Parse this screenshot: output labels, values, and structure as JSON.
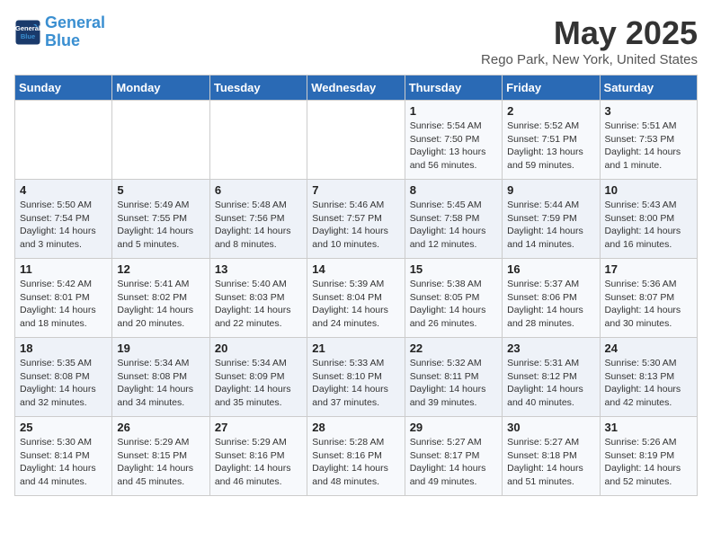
{
  "logo": {
    "line1": "General",
    "line2": "Blue"
  },
  "title": "May 2025",
  "subtitle": "Rego Park, New York, United States",
  "headers": [
    "Sunday",
    "Monday",
    "Tuesday",
    "Wednesday",
    "Thursday",
    "Friday",
    "Saturday"
  ],
  "weeks": [
    [
      {
        "num": "",
        "info": ""
      },
      {
        "num": "",
        "info": ""
      },
      {
        "num": "",
        "info": ""
      },
      {
        "num": "",
        "info": ""
      },
      {
        "num": "1",
        "info": "Sunrise: 5:54 AM\nSunset: 7:50 PM\nDaylight: 13 hours\nand 56 minutes."
      },
      {
        "num": "2",
        "info": "Sunrise: 5:52 AM\nSunset: 7:51 PM\nDaylight: 13 hours\nand 59 minutes."
      },
      {
        "num": "3",
        "info": "Sunrise: 5:51 AM\nSunset: 7:53 PM\nDaylight: 14 hours\nand 1 minute."
      }
    ],
    [
      {
        "num": "4",
        "info": "Sunrise: 5:50 AM\nSunset: 7:54 PM\nDaylight: 14 hours\nand 3 minutes."
      },
      {
        "num": "5",
        "info": "Sunrise: 5:49 AM\nSunset: 7:55 PM\nDaylight: 14 hours\nand 5 minutes."
      },
      {
        "num": "6",
        "info": "Sunrise: 5:48 AM\nSunset: 7:56 PM\nDaylight: 14 hours\nand 8 minutes."
      },
      {
        "num": "7",
        "info": "Sunrise: 5:46 AM\nSunset: 7:57 PM\nDaylight: 14 hours\nand 10 minutes."
      },
      {
        "num": "8",
        "info": "Sunrise: 5:45 AM\nSunset: 7:58 PM\nDaylight: 14 hours\nand 12 minutes."
      },
      {
        "num": "9",
        "info": "Sunrise: 5:44 AM\nSunset: 7:59 PM\nDaylight: 14 hours\nand 14 minutes."
      },
      {
        "num": "10",
        "info": "Sunrise: 5:43 AM\nSunset: 8:00 PM\nDaylight: 14 hours\nand 16 minutes."
      }
    ],
    [
      {
        "num": "11",
        "info": "Sunrise: 5:42 AM\nSunset: 8:01 PM\nDaylight: 14 hours\nand 18 minutes."
      },
      {
        "num": "12",
        "info": "Sunrise: 5:41 AM\nSunset: 8:02 PM\nDaylight: 14 hours\nand 20 minutes."
      },
      {
        "num": "13",
        "info": "Sunrise: 5:40 AM\nSunset: 8:03 PM\nDaylight: 14 hours\nand 22 minutes."
      },
      {
        "num": "14",
        "info": "Sunrise: 5:39 AM\nSunset: 8:04 PM\nDaylight: 14 hours\nand 24 minutes."
      },
      {
        "num": "15",
        "info": "Sunrise: 5:38 AM\nSunset: 8:05 PM\nDaylight: 14 hours\nand 26 minutes."
      },
      {
        "num": "16",
        "info": "Sunrise: 5:37 AM\nSunset: 8:06 PM\nDaylight: 14 hours\nand 28 minutes."
      },
      {
        "num": "17",
        "info": "Sunrise: 5:36 AM\nSunset: 8:07 PM\nDaylight: 14 hours\nand 30 minutes."
      }
    ],
    [
      {
        "num": "18",
        "info": "Sunrise: 5:35 AM\nSunset: 8:08 PM\nDaylight: 14 hours\nand 32 minutes."
      },
      {
        "num": "19",
        "info": "Sunrise: 5:34 AM\nSunset: 8:08 PM\nDaylight: 14 hours\nand 34 minutes."
      },
      {
        "num": "20",
        "info": "Sunrise: 5:34 AM\nSunset: 8:09 PM\nDaylight: 14 hours\nand 35 minutes."
      },
      {
        "num": "21",
        "info": "Sunrise: 5:33 AM\nSunset: 8:10 PM\nDaylight: 14 hours\nand 37 minutes."
      },
      {
        "num": "22",
        "info": "Sunrise: 5:32 AM\nSunset: 8:11 PM\nDaylight: 14 hours\nand 39 minutes."
      },
      {
        "num": "23",
        "info": "Sunrise: 5:31 AM\nSunset: 8:12 PM\nDaylight: 14 hours\nand 40 minutes."
      },
      {
        "num": "24",
        "info": "Sunrise: 5:30 AM\nSunset: 8:13 PM\nDaylight: 14 hours\nand 42 minutes."
      }
    ],
    [
      {
        "num": "25",
        "info": "Sunrise: 5:30 AM\nSunset: 8:14 PM\nDaylight: 14 hours\nand 44 minutes."
      },
      {
        "num": "26",
        "info": "Sunrise: 5:29 AM\nSunset: 8:15 PM\nDaylight: 14 hours\nand 45 minutes."
      },
      {
        "num": "27",
        "info": "Sunrise: 5:29 AM\nSunset: 8:16 PM\nDaylight: 14 hours\nand 46 minutes."
      },
      {
        "num": "28",
        "info": "Sunrise: 5:28 AM\nSunset: 8:16 PM\nDaylight: 14 hours\nand 48 minutes."
      },
      {
        "num": "29",
        "info": "Sunrise: 5:27 AM\nSunset: 8:17 PM\nDaylight: 14 hours\nand 49 minutes."
      },
      {
        "num": "30",
        "info": "Sunrise: 5:27 AM\nSunset: 8:18 PM\nDaylight: 14 hours\nand 51 minutes."
      },
      {
        "num": "31",
        "info": "Sunrise: 5:26 AM\nSunset: 8:19 PM\nDaylight: 14 hours\nand 52 minutes."
      }
    ]
  ]
}
